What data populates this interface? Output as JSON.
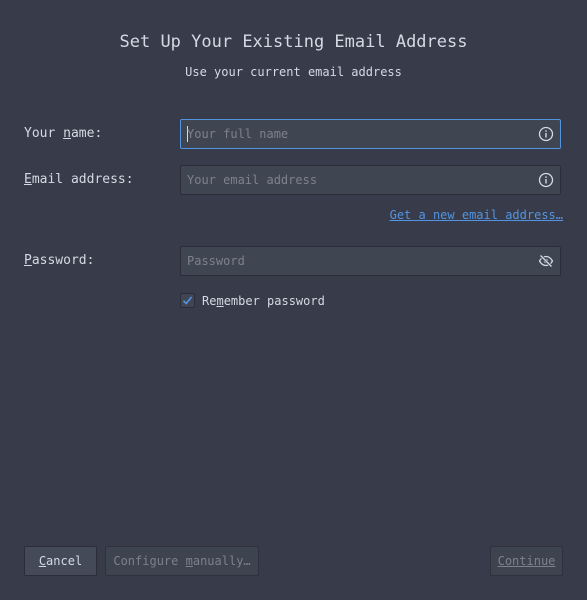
{
  "dialog": {
    "title": "Set Up Your Existing Email Address",
    "subtitle": "Use your current email address"
  },
  "form": {
    "name": {
      "label_pre": "Your ",
      "label_mnemonic": "n",
      "label_post": "ame:",
      "placeholder": "Your full name",
      "value": "",
      "icon": "info-icon"
    },
    "email": {
      "label_pre": "",
      "label_mnemonic": "E",
      "label_post": "mail address:",
      "placeholder": "Your email address",
      "value": "",
      "icon": "info-icon"
    },
    "new_email_link": "Get a new email address…",
    "password": {
      "label_pre": "",
      "label_mnemonic": "P",
      "label_post": "assword:",
      "placeholder": "Password",
      "value": "",
      "icon": "eye-slash-icon"
    },
    "remember": {
      "label_pre": "Re",
      "label_mnemonic": "m",
      "label_post": "ember password",
      "checked": true
    }
  },
  "buttons": {
    "cancel_pre": "",
    "cancel_mnemonic": "C",
    "cancel_post": "ancel",
    "configure_pre": "Configure ",
    "configure_mnemonic": "m",
    "configure_post": "anually…",
    "continue_label": "Continue"
  },
  "colors": {
    "background": "#383c4a",
    "accent": "#5294e2",
    "text": "#d3dae3",
    "placeholder": "#7c818c"
  }
}
